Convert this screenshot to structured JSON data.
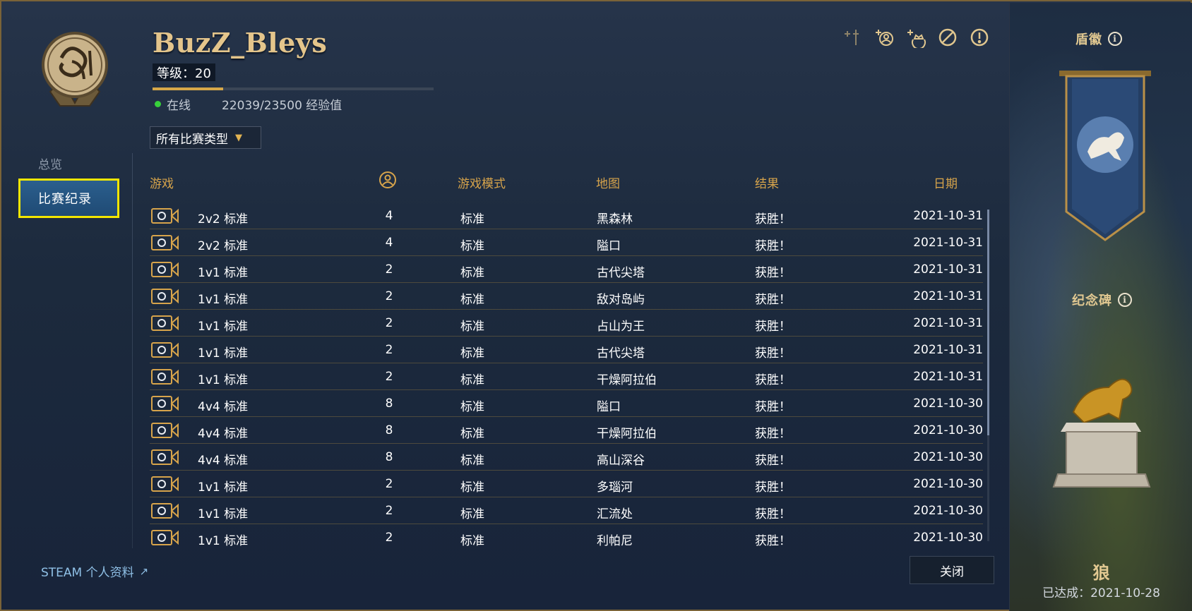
{
  "sidebar": {
    "overview_label": "总览",
    "history_label": "比赛纪录",
    "steam_label": "STEAM 个人资料"
  },
  "profile": {
    "name": "BuzZ_Bleys",
    "level": "等级：20",
    "xp_fraction": 0.25,
    "status": "在线",
    "xp_text": "22039/23500 经验值"
  },
  "filter": {
    "label": "所有比赛类型"
  },
  "action_icons": [
    "sword-plus-icon",
    "add-friend-icon",
    "add-crown-icon",
    "block-icon",
    "report-icon"
  ],
  "table": {
    "headers": {
      "game": "游戏",
      "players_icon": "player-count-icon",
      "mode": "游戏模式",
      "map": "地图",
      "result": "结果",
      "date": "日期"
    },
    "rows": [
      {
        "game": "2v2 标准",
        "players": "4",
        "mode": "标准",
        "map": "黑森林",
        "result": "获胜！",
        "date": "2021-10-31"
      },
      {
        "game": "2v2 标准",
        "players": "4",
        "mode": "标准",
        "map": "隘口",
        "result": "获胜！",
        "date": "2021-10-31"
      },
      {
        "game": "1v1 标准",
        "players": "2",
        "mode": "标准",
        "map": "古代尖塔",
        "result": "获胜！",
        "date": "2021-10-31"
      },
      {
        "game": "1v1 标准",
        "players": "2",
        "mode": "标准",
        "map": "敌对岛屿",
        "result": "获胜！",
        "date": "2021-10-31"
      },
      {
        "game": "1v1 标准",
        "players": "2",
        "mode": "标准",
        "map": "占山为王",
        "result": "获胜！",
        "date": "2021-10-31"
      },
      {
        "game": "1v1 标准",
        "players": "2",
        "mode": "标准",
        "map": "古代尖塔",
        "result": "获胜！",
        "date": "2021-10-31"
      },
      {
        "game": "1v1 标准",
        "players": "2",
        "mode": "标准",
        "map": "干燥阿拉伯",
        "result": "获胜！",
        "date": "2021-10-31"
      },
      {
        "game": "4v4 标准",
        "players": "8",
        "mode": "标准",
        "map": "隘口",
        "result": "获胜！",
        "date": "2021-10-30"
      },
      {
        "game": "4v4 标准",
        "players": "8",
        "mode": "标准",
        "map": "干燥阿拉伯",
        "result": "获胜！",
        "date": "2021-10-30"
      },
      {
        "game": "4v4 标准",
        "players": "8",
        "mode": "标准",
        "map": "高山深谷",
        "result": "获胜！",
        "date": "2021-10-30"
      },
      {
        "game": "1v1 标准",
        "players": "2",
        "mode": "标准",
        "map": "多瑙河",
        "result": "获胜！",
        "date": "2021-10-30"
      },
      {
        "game": "1v1 标准",
        "players": "2",
        "mode": "标准",
        "map": "汇流处",
        "result": "获胜！",
        "date": "2021-10-30"
      },
      {
        "game": "1v1 标准",
        "players": "2",
        "mode": "标准",
        "map": "利帕尼",
        "result": "获胜！",
        "date": "2021-10-30"
      }
    ]
  },
  "close_label": "关闭",
  "right_panel": {
    "emblem_title": "盾徽",
    "monument_title": "纪念碑",
    "monument_name": "狼",
    "achieved": "已达成：2021-10-28"
  },
  "colors": {
    "accent_gold": "#d7a44b",
    "selected_nav": "#1f4a74",
    "highlight_border": "#f2e600",
    "online": "#37d03b"
  }
}
